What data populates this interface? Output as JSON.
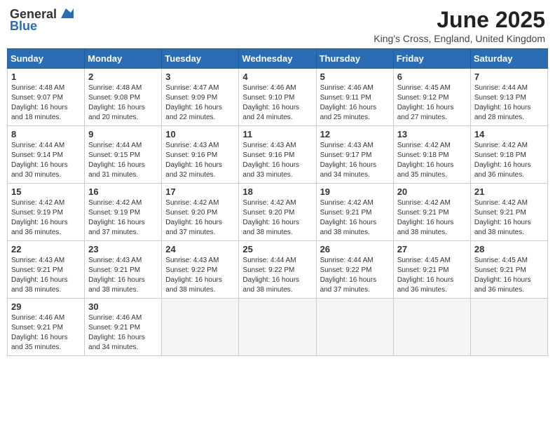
{
  "header": {
    "logo_general": "General",
    "logo_blue": "Blue",
    "main_title": "June 2025",
    "subtitle": "King's Cross, England, United Kingdom"
  },
  "weekdays": [
    "Sunday",
    "Monday",
    "Tuesday",
    "Wednesday",
    "Thursday",
    "Friday",
    "Saturday"
  ],
  "weeks": [
    [
      {
        "day": "1",
        "info": "Sunrise: 4:48 AM\nSunset: 9:07 PM\nDaylight: 16 hours and 18 minutes."
      },
      {
        "day": "2",
        "info": "Sunrise: 4:48 AM\nSunset: 9:08 PM\nDaylight: 16 hours and 20 minutes."
      },
      {
        "day": "3",
        "info": "Sunrise: 4:47 AM\nSunset: 9:09 PM\nDaylight: 16 hours and 22 minutes."
      },
      {
        "day": "4",
        "info": "Sunrise: 4:46 AM\nSunset: 9:10 PM\nDaylight: 16 hours and 24 minutes."
      },
      {
        "day": "5",
        "info": "Sunrise: 4:46 AM\nSunset: 9:11 PM\nDaylight: 16 hours and 25 minutes."
      },
      {
        "day": "6",
        "info": "Sunrise: 4:45 AM\nSunset: 9:12 PM\nDaylight: 16 hours and 27 minutes."
      },
      {
        "day": "7",
        "info": "Sunrise: 4:44 AM\nSunset: 9:13 PM\nDaylight: 16 hours and 28 minutes."
      }
    ],
    [
      {
        "day": "8",
        "info": "Sunrise: 4:44 AM\nSunset: 9:14 PM\nDaylight: 16 hours and 30 minutes."
      },
      {
        "day": "9",
        "info": "Sunrise: 4:44 AM\nSunset: 9:15 PM\nDaylight: 16 hours and 31 minutes."
      },
      {
        "day": "10",
        "info": "Sunrise: 4:43 AM\nSunset: 9:16 PM\nDaylight: 16 hours and 32 minutes."
      },
      {
        "day": "11",
        "info": "Sunrise: 4:43 AM\nSunset: 9:16 PM\nDaylight: 16 hours and 33 minutes."
      },
      {
        "day": "12",
        "info": "Sunrise: 4:43 AM\nSunset: 9:17 PM\nDaylight: 16 hours and 34 minutes."
      },
      {
        "day": "13",
        "info": "Sunrise: 4:42 AM\nSunset: 9:18 PM\nDaylight: 16 hours and 35 minutes."
      },
      {
        "day": "14",
        "info": "Sunrise: 4:42 AM\nSunset: 9:18 PM\nDaylight: 16 hours and 36 minutes."
      }
    ],
    [
      {
        "day": "15",
        "info": "Sunrise: 4:42 AM\nSunset: 9:19 PM\nDaylight: 16 hours and 36 minutes."
      },
      {
        "day": "16",
        "info": "Sunrise: 4:42 AM\nSunset: 9:19 PM\nDaylight: 16 hours and 37 minutes."
      },
      {
        "day": "17",
        "info": "Sunrise: 4:42 AM\nSunset: 9:20 PM\nDaylight: 16 hours and 37 minutes."
      },
      {
        "day": "18",
        "info": "Sunrise: 4:42 AM\nSunset: 9:20 PM\nDaylight: 16 hours and 38 minutes."
      },
      {
        "day": "19",
        "info": "Sunrise: 4:42 AM\nSunset: 9:21 PM\nDaylight: 16 hours and 38 minutes."
      },
      {
        "day": "20",
        "info": "Sunrise: 4:42 AM\nSunset: 9:21 PM\nDaylight: 16 hours and 38 minutes."
      },
      {
        "day": "21",
        "info": "Sunrise: 4:42 AM\nSunset: 9:21 PM\nDaylight: 16 hours and 38 minutes."
      }
    ],
    [
      {
        "day": "22",
        "info": "Sunrise: 4:43 AM\nSunset: 9:21 PM\nDaylight: 16 hours and 38 minutes."
      },
      {
        "day": "23",
        "info": "Sunrise: 4:43 AM\nSunset: 9:21 PM\nDaylight: 16 hours and 38 minutes."
      },
      {
        "day": "24",
        "info": "Sunrise: 4:43 AM\nSunset: 9:22 PM\nDaylight: 16 hours and 38 minutes."
      },
      {
        "day": "25",
        "info": "Sunrise: 4:44 AM\nSunset: 9:22 PM\nDaylight: 16 hours and 38 minutes."
      },
      {
        "day": "26",
        "info": "Sunrise: 4:44 AM\nSunset: 9:22 PM\nDaylight: 16 hours and 37 minutes."
      },
      {
        "day": "27",
        "info": "Sunrise: 4:45 AM\nSunset: 9:21 PM\nDaylight: 16 hours and 36 minutes."
      },
      {
        "day": "28",
        "info": "Sunrise: 4:45 AM\nSunset: 9:21 PM\nDaylight: 16 hours and 36 minutes."
      }
    ],
    [
      {
        "day": "29",
        "info": "Sunrise: 4:46 AM\nSunset: 9:21 PM\nDaylight: 16 hours and 35 minutes."
      },
      {
        "day": "30",
        "info": "Sunrise: 4:46 AM\nSunset: 9:21 PM\nDaylight: 16 hours and 34 minutes."
      },
      {
        "day": "",
        "info": ""
      },
      {
        "day": "",
        "info": ""
      },
      {
        "day": "",
        "info": ""
      },
      {
        "day": "",
        "info": ""
      },
      {
        "day": "",
        "info": ""
      }
    ]
  ]
}
